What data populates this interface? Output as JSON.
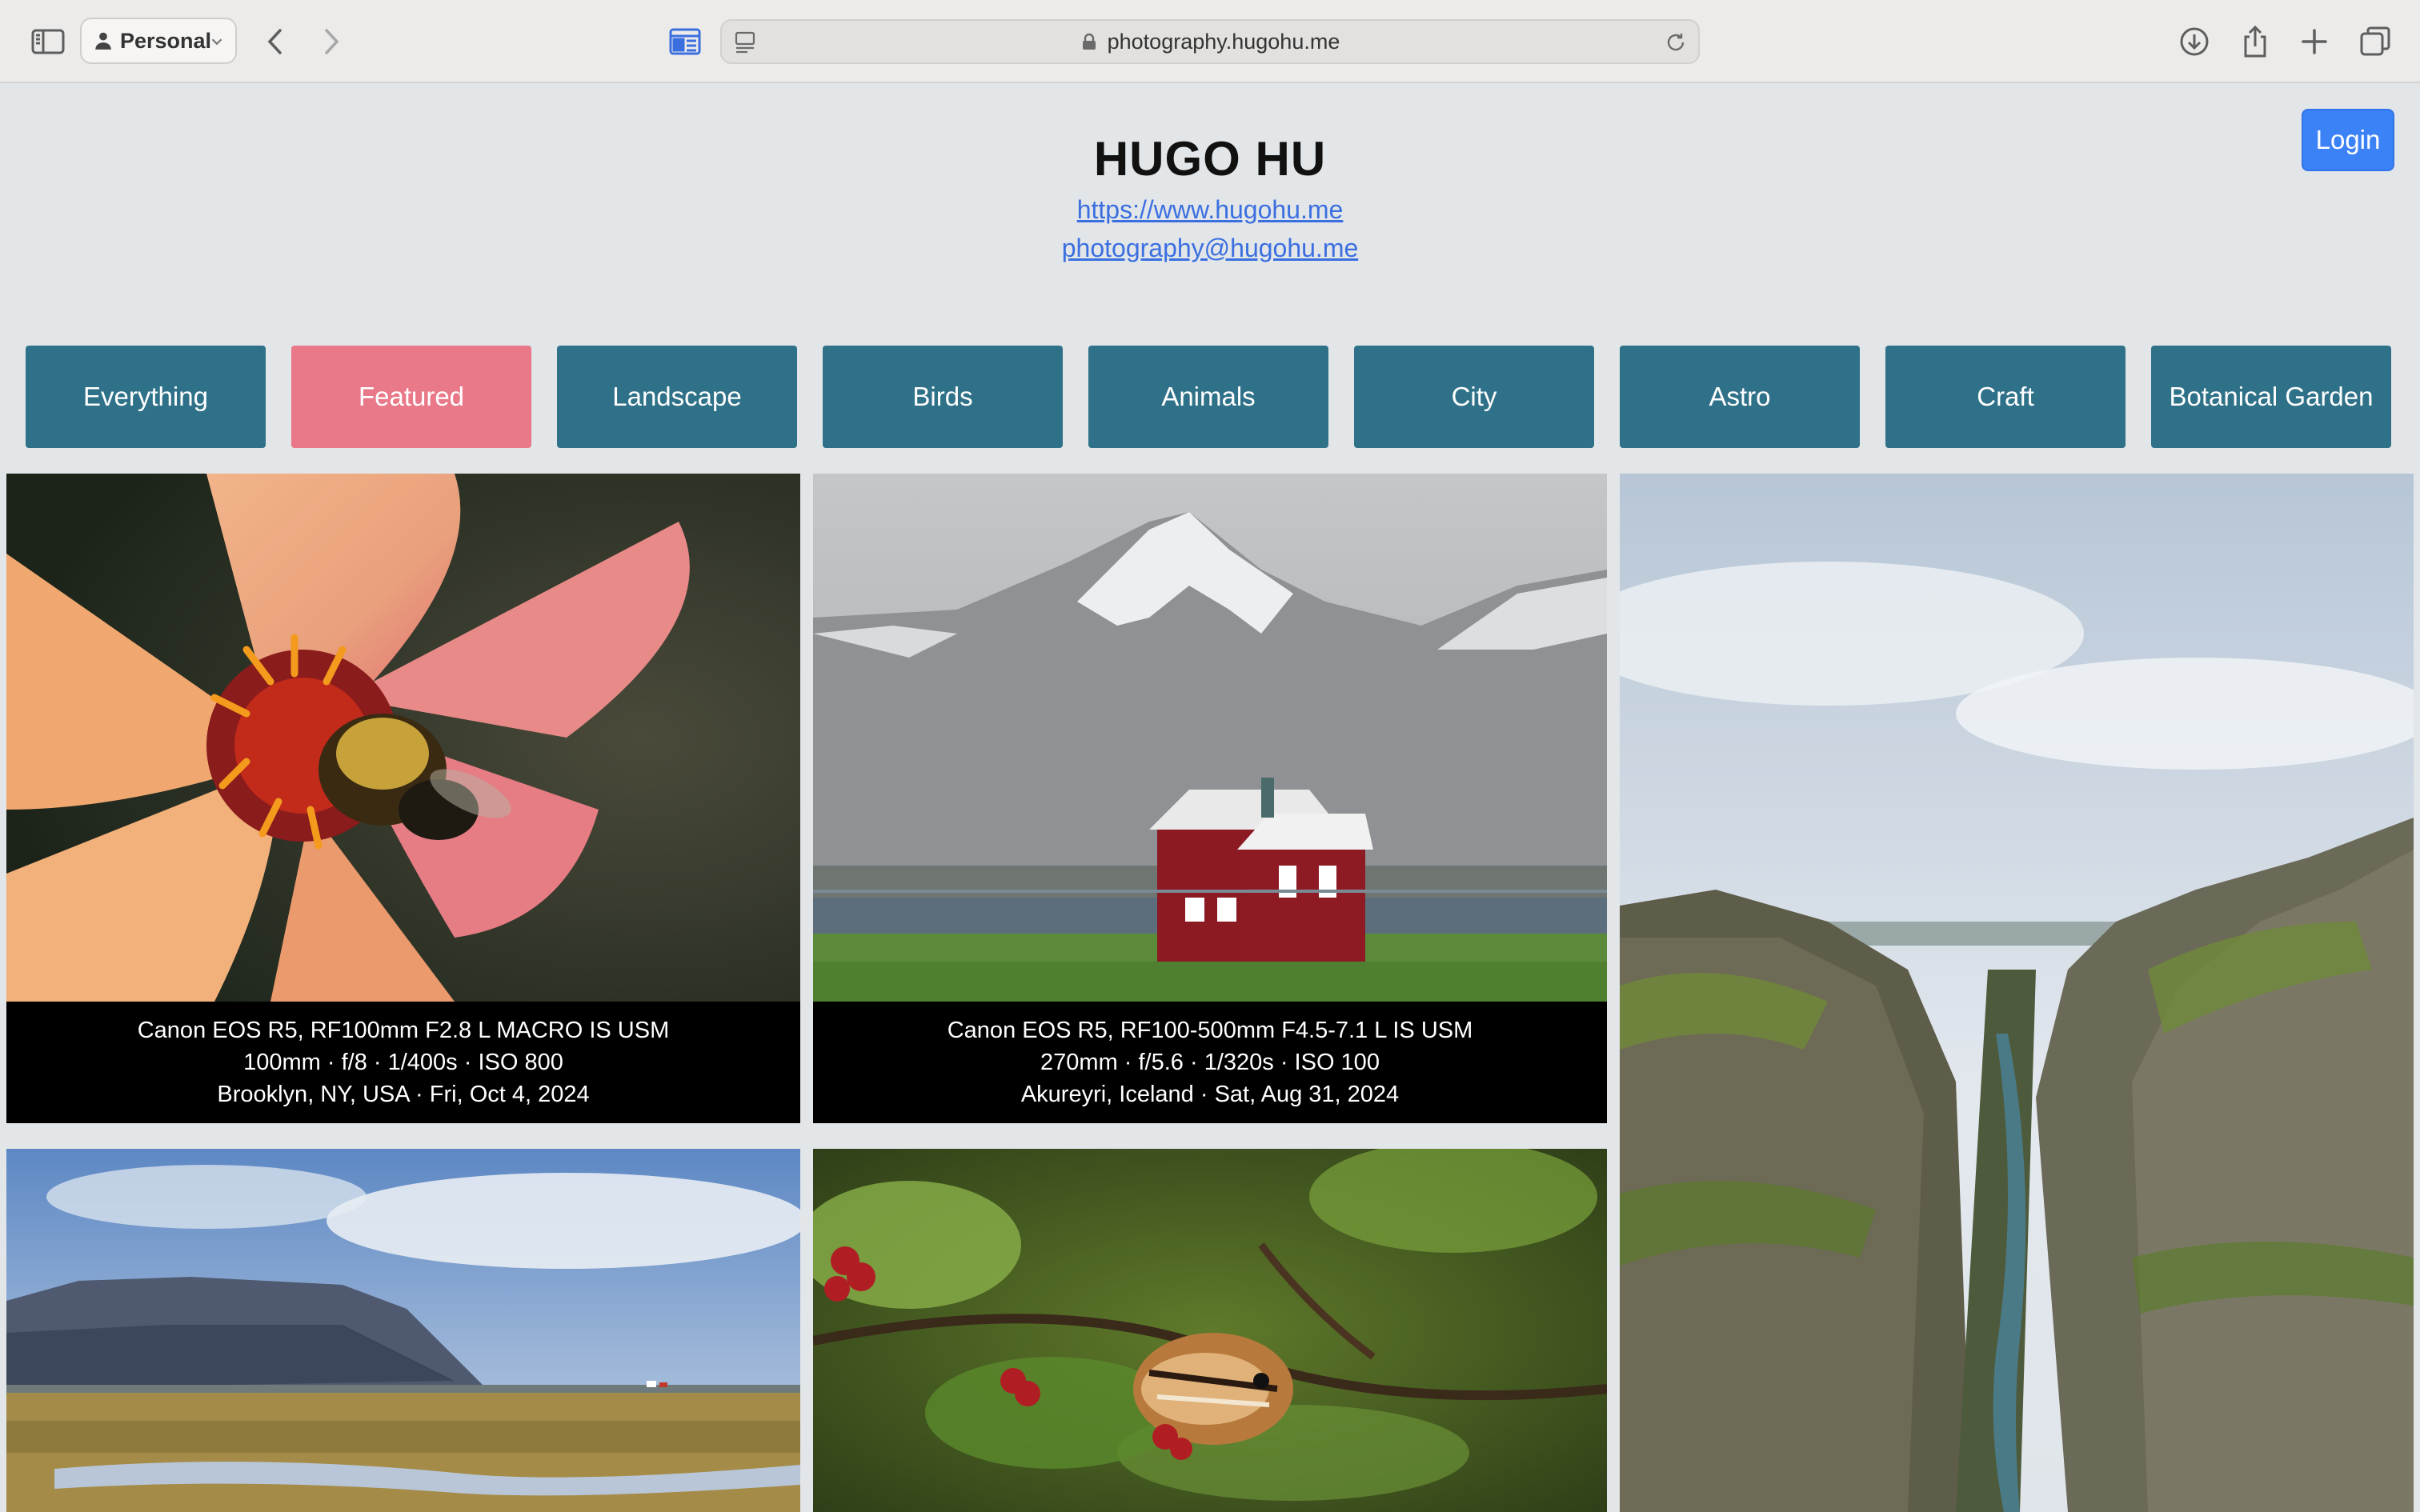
{
  "browser": {
    "profile_label": "Personal",
    "url": "photography.hugohu.me"
  },
  "site": {
    "title": "HUGO HU",
    "website_link": "https://www.hugohu.me",
    "email_link": "photography@hugohu.me",
    "login_label": "Login"
  },
  "categories": [
    {
      "label": "Everything",
      "active": false
    },
    {
      "label": "Featured",
      "active": true
    },
    {
      "label": "Landscape",
      "active": false
    },
    {
      "label": "Birds",
      "active": false
    },
    {
      "label": "Animals",
      "active": false
    },
    {
      "label": "City",
      "active": false
    },
    {
      "label": "Astro",
      "active": false
    },
    {
      "label": "Craft",
      "active": false
    },
    {
      "label": "Botanical Garden",
      "active": false
    }
  ],
  "photos": [
    {
      "subject": "bee on dahlia flower",
      "caption": [
        "Canon EOS R5, RF100mm F2.8 L MACRO IS USM",
        "100mm · f/8 · 1/400s · ISO 800",
        "Brooklyn, NY, USA · Fri, Oct 4, 2024"
      ]
    },
    {
      "subject": "red house beneath snowy mountain",
      "caption": [
        "Canon EOS R5, RF100-500mm F4.5-7.1 L IS USM",
        "270mm · f/5.6 · 1/320s · ISO 100",
        "Akureyri, Iceland · Sat, Aug 31, 2024"
      ]
    },
    {
      "subject": "mossy canyon with river"
    },
    {
      "subject": "flat-topped mountain over wetland"
    },
    {
      "subject": "chipmunk eating berries"
    }
  ],
  "colors": {
    "category_bg": "#2f7189",
    "category_active_bg": "#e97888",
    "login_bg": "#3b82f6",
    "link": "#3b6fe0",
    "page_bg": "#e3e6e8"
  }
}
